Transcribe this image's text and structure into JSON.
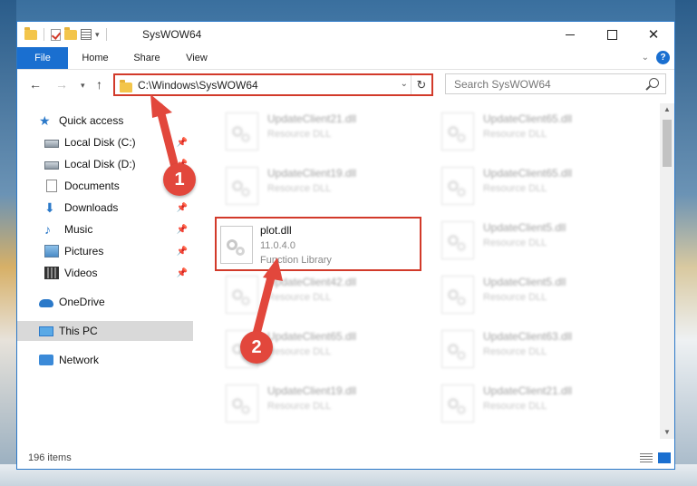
{
  "window": {
    "title": "SysWOW64",
    "controls": {
      "minimize": "",
      "maximize": "",
      "close": "✕"
    }
  },
  "ribbon": {
    "tabs": [
      "File",
      "Home",
      "Share",
      "View"
    ],
    "help": "?"
  },
  "navigation": {
    "back": "←",
    "forward": "→",
    "recent": "▾",
    "up": "↑",
    "address": "C:\\Windows\\SysWOW64",
    "refresh": "↻",
    "search_placeholder": "Search SysWOW64"
  },
  "nav_pane": [
    {
      "label": "Quick access",
      "icon": "star-icon",
      "pinned": false
    },
    {
      "label": "Local Disk (C:)",
      "icon": "disk-icon",
      "pinned": true
    },
    {
      "label": "Local Disk (D:)",
      "icon": "disk-icon",
      "pinned": true
    },
    {
      "label": "Documents",
      "icon": "document-icon",
      "pinned": true
    },
    {
      "label": "Downloads",
      "icon": "download-icon",
      "pinned": true
    },
    {
      "label": "Music",
      "icon": "music-icon",
      "pinned": true
    },
    {
      "label": "Pictures",
      "icon": "pictures-icon",
      "pinned": true
    },
    {
      "label": "Videos",
      "icon": "videos-icon",
      "pinned": true
    },
    {
      "label": "OneDrive",
      "icon": "onedrive-icon",
      "pinned": false
    },
    {
      "label": "This PC",
      "icon": "this-pc-icon",
      "pinned": false,
      "selected": true
    },
    {
      "label": "Network",
      "icon": "network-icon",
      "pinned": false
    }
  ],
  "files": {
    "left_column": [
      {
        "name": "UpdateClient21.dll",
        "type": "Resource DLL"
      },
      {
        "name": "UpdateClient19.dll",
        "type": "Resource DLL"
      },
      {
        "name": "plot.dll",
        "version": "11.0.4.0",
        "type": "Function Library",
        "highlighted": true
      },
      {
        "name": "UpdateClient42.dll",
        "type": "Resource DLL"
      },
      {
        "name": "UpdateClient65.dll",
        "type": "Resource DLL"
      },
      {
        "name": "UpdateClient19.dll",
        "type": "Resource DLL"
      }
    ],
    "right_column": [
      {
        "name": "UpdateClient65.dll",
        "type": "Resource DLL"
      },
      {
        "name": "UpdateClient65.dll",
        "type": "Resource DLL"
      },
      {
        "name": "UpdateClient5.dll",
        "type": "Resource DLL"
      },
      {
        "name": "UpdateClient5.dll",
        "type": "Resource DLL"
      },
      {
        "name": "UpdateClient63.dll",
        "type": "Resource DLL"
      },
      {
        "name": "UpdateClient21.dll",
        "type": "Resource DLL"
      }
    ]
  },
  "status": {
    "item_count": "196 items"
  },
  "annotations": {
    "step1": "1",
    "step2": "2"
  },
  "colors": {
    "accent": "#1a6fd0",
    "highlight": "#d23a2a",
    "badge": "#e2473c"
  }
}
